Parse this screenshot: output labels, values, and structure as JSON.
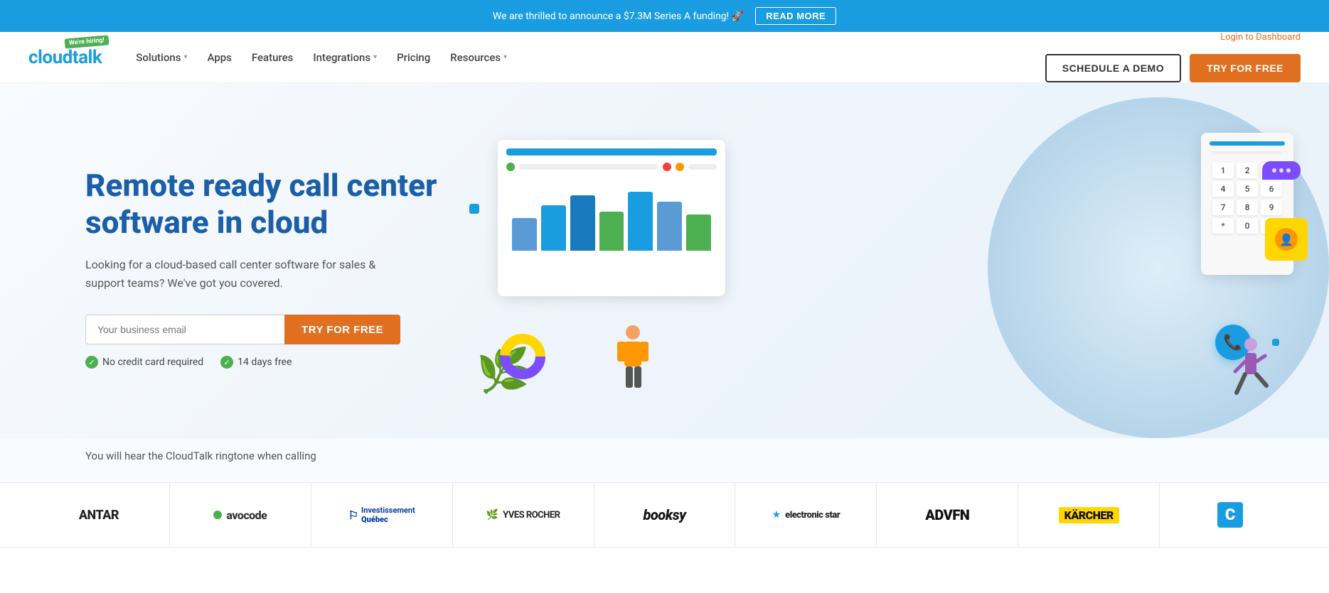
{
  "announcement": {
    "text": "We are thrilled to announce a $7.3M Series A funding! 🚀",
    "cta": "READ MORE"
  },
  "header": {
    "logo": "cloudtalk",
    "hiring_badge": "We're hiring!",
    "nav": [
      {
        "label": "Solutions",
        "has_dropdown": true
      },
      {
        "label": "Apps",
        "has_dropdown": false
      },
      {
        "label": "Features",
        "has_dropdown": false
      },
      {
        "label": "Integrations",
        "has_dropdown": true
      },
      {
        "label": "Pricing",
        "has_dropdown": false
      },
      {
        "label": "Resources",
        "has_dropdown": true
      }
    ],
    "login_link": "Login to Dashboard",
    "schedule_demo": "SCHEDULE A DEMO",
    "try_free": "TRY FOR FREE"
  },
  "hero": {
    "title": "Remote ready call center software in cloud",
    "subtitle": "Looking for a cloud-based call center software for sales & support teams? We've got you covered.",
    "email_placeholder": "Your business email",
    "cta_button": "TRY FOR FREE",
    "badges": [
      {
        "icon": "check",
        "text": "No credit card required"
      },
      {
        "icon": "check",
        "text": "14 days free"
      }
    ]
  },
  "ringtone": {
    "text": "You will hear the CloudTalk ringtone when calling"
  },
  "logos": [
    {
      "name": "ANTAR",
      "type": "text"
    },
    {
      "name": "avocode",
      "type": "with_dot"
    },
    {
      "name": "Investissement Québec",
      "type": "invest"
    },
    {
      "name": "YVES ROCHER",
      "type": "yves"
    },
    {
      "name": "booksy",
      "type": "text_italic"
    },
    {
      "name": "electronic star",
      "type": "star"
    },
    {
      "name": "ADVFN",
      "type": "text_bold"
    },
    {
      "name": "KÄRCHER",
      "type": "karcher"
    },
    {
      "name": "C",
      "type": "c_logo"
    }
  ],
  "colors": {
    "primary_blue": "#1a9de0",
    "dark_blue": "#1a5fa8",
    "orange": "#e07020",
    "green": "#4caf50",
    "purple": "#7c4dff",
    "yellow": "#ffd600"
  }
}
